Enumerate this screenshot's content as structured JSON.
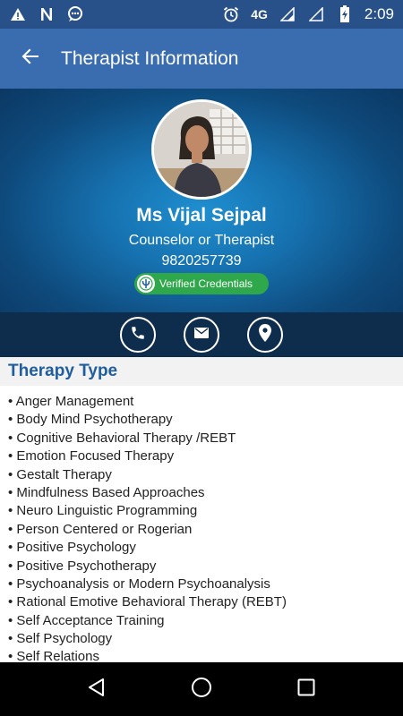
{
  "status_bar": {
    "time": "2:09",
    "network": "4G",
    "left_icons": [
      "warning-icon",
      "n-notification-icon",
      "chat-notification-icon"
    ],
    "right_icons": [
      "alarm-icon",
      "signal-icon",
      "signal-icon",
      "battery-charging-icon"
    ]
  },
  "app_bar": {
    "title": "Therapist Information",
    "back_icon": "arrow-back-icon"
  },
  "profile": {
    "name": "Ms Vijal Sejpal",
    "role": "Counselor or Therapist",
    "phone": "9820257739",
    "badge_label": "Verified Credentials"
  },
  "actions": {
    "call_icon": "phone-icon",
    "email_icon": "mail-icon",
    "location_icon": "location-pin-icon"
  },
  "therapy_section": {
    "title": "Therapy Type",
    "items": [
      "Anger Management",
      "Body Mind Psychotherapy",
      "Cognitive Behavioral Therapy /REBT",
      "Emotion Focused Therapy",
      "Gestalt Therapy",
      "Mindfulness Based Approaches",
      "Neuro Linguistic Programming",
      "Person Centered or Rogerian",
      "Positive Psychology",
      "Positive Psychotherapy",
      "Psychoanalysis or Modern Psychoanalysis",
      "Rational Emotive Behavioral Therapy (REBT)",
      "Self Acceptance Training",
      "Self Psychology",
      "Self Relations"
    ]
  },
  "colors": {
    "status_bar": "#28518a",
    "app_bar": "#3a6db0",
    "hero_center": "#1f8fd0",
    "action_bar": "#0e2c4c",
    "badge": "#2ea84a",
    "section_title": "#1f5d9e"
  }
}
